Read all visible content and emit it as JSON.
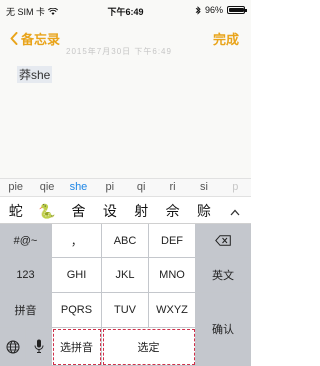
{
  "status": {
    "carrier": "无 SIM 卡",
    "time": "下午6:49",
    "battery_pct_text": "96%",
    "battery_level": 0.96
  },
  "nav": {
    "back_label": "备忘录",
    "done_label": "完成"
  },
  "note": {
    "date_text": "2015年7月30日 下午6:49",
    "composing_text": "莽she"
  },
  "pinyin_options": [
    "pie",
    "qie",
    "she",
    "pi",
    "qi",
    "ri",
    "si",
    "p"
  ],
  "candidates": [
    "蛇",
    "🐍",
    "舍",
    "设",
    "射",
    "佘",
    "赊"
  ],
  "keyboard": {
    "symbols": "#@~",
    "digits": "123",
    "pinyin_mode": "拼音",
    "comma": "，",
    "abc": "ABC",
    "def": "DEF",
    "ghi": "GHI",
    "jkl": "JKL",
    "mno": "MNO",
    "pqrs": "PQRS",
    "tuv": "TUV",
    "wxyz": "WXYZ",
    "english": "英文",
    "select_pinyin": "选拼音",
    "select": "选定",
    "confirm": "确认"
  },
  "colors": {
    "accent": "#e9a41a",
    "active_pinyin": "#1e86e6"
  }
}
